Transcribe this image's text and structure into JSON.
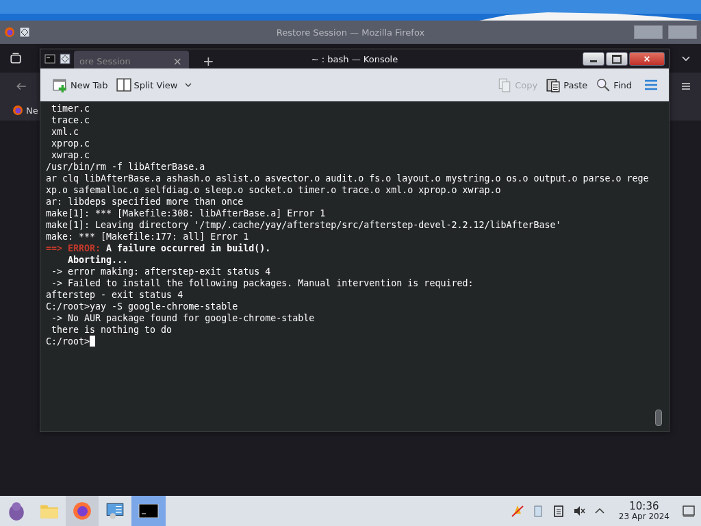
{
  "firefox": {
    "title": "Restore Session — Mozilla Firefox",
    "tab": "ore Session",
    "tab_close": "×",
    "new_tab": "+",
    "bookmark": "Ne"
  },
  "konsole": {
    "title": "~ : bash — Konsole",
    "toolbar_left": [
      {
        "label": "New Tab",
        "kind": "newtab",
        "disabled": false
      },
      {
        "label": "Split View",
        "kind": "split",
        "disabled": false
      }
    ],
    "toolbar_right": [
      {
        "label": "Copy",
        "kind": "copy",
        "disabled": true
      },
      {
        "label": "Paste",
        "kind": "paste",
        "disabled": false
      },
      {
        "label": "Find",
        "kind": "find",
        "disabled": false
      }
    ],
    "lines": [
      {
        "kind": "text",
        "text": " timer.c"
      },
      {
        "kind": "text",
        "text": " trace.c"
      },
      {
        "kind": "text",
        "text": " xml.c"
      },
      {
        "kind": "text",
        "text": " xprop.c"
      },
      {
        "kind": "text",
        "text": " xwrap.c"
      },
      {
        "kind": "text",
        "text": "/usr/bin/rm -f libAfterBase.a"
      },
      {
        "kind": "text",
        "text": "ar clq libAfterBase.a ashash.o aslist.o asvector.o audit.o fs.o layout.o mystring.o os.o output.o parse.o rege"
      },
      {
        "kind": "text",
        "text": "xp.o safemalloc.o selfdiag.o sleep.o socket.o timer.o trace.o xml.o xprop.o xwrap.o"
      },
      {
        "kind": "text",
        "text": "ar: libdeps specified more than once"
      },
      {
        "kind": "text",
        "text": "make[1]: *** [Makefile:308: libAfterBase.a] Error 1"
      },
      {
        "kind": "text",
        "text": "make[1]: Leaving directory '/tmp/.cache/yay/afterstep/src/afterstep-devel-2.2.12/libAfterBase'"
      },
      {
        "kind": "text",
        "text": "make: *** [Makefile:177: all] Error 1"
      },
      {
        "kind": "error",
        "marker": "==> ERROR:",
        "text": "A failure occurred in build()."
      },
      {
        "kind": "bold",
        "text": "    Aborting..."
      },
      {
        "kind": "text",
        "text": " -> error making: afterstep-exit status 4"
      },
      {
        "kind": "text",
        "text": " -> Failed to install the following packages. Manual intervention is required:"
      },
      {
        "kind": "text",
        "text": "afterstep - exit status 4"
      },
      {
        "kind": "text",
        "text": "C:/root>yay -S google-chrome-stable"
      },
      {
        "kind": "text",
        "text": " -> No AUR package found for google-chrome-stable"
      },
      {
        "kind": "text",
        "text": " there is nothing to do"
      },
      {
        "kind": "prompt",
        "text": "C:/root>"
      }
    ]
  },
  "taskbar": {
    "time": "10:36",
    "date": "23 Apr 2024"
  }
}
